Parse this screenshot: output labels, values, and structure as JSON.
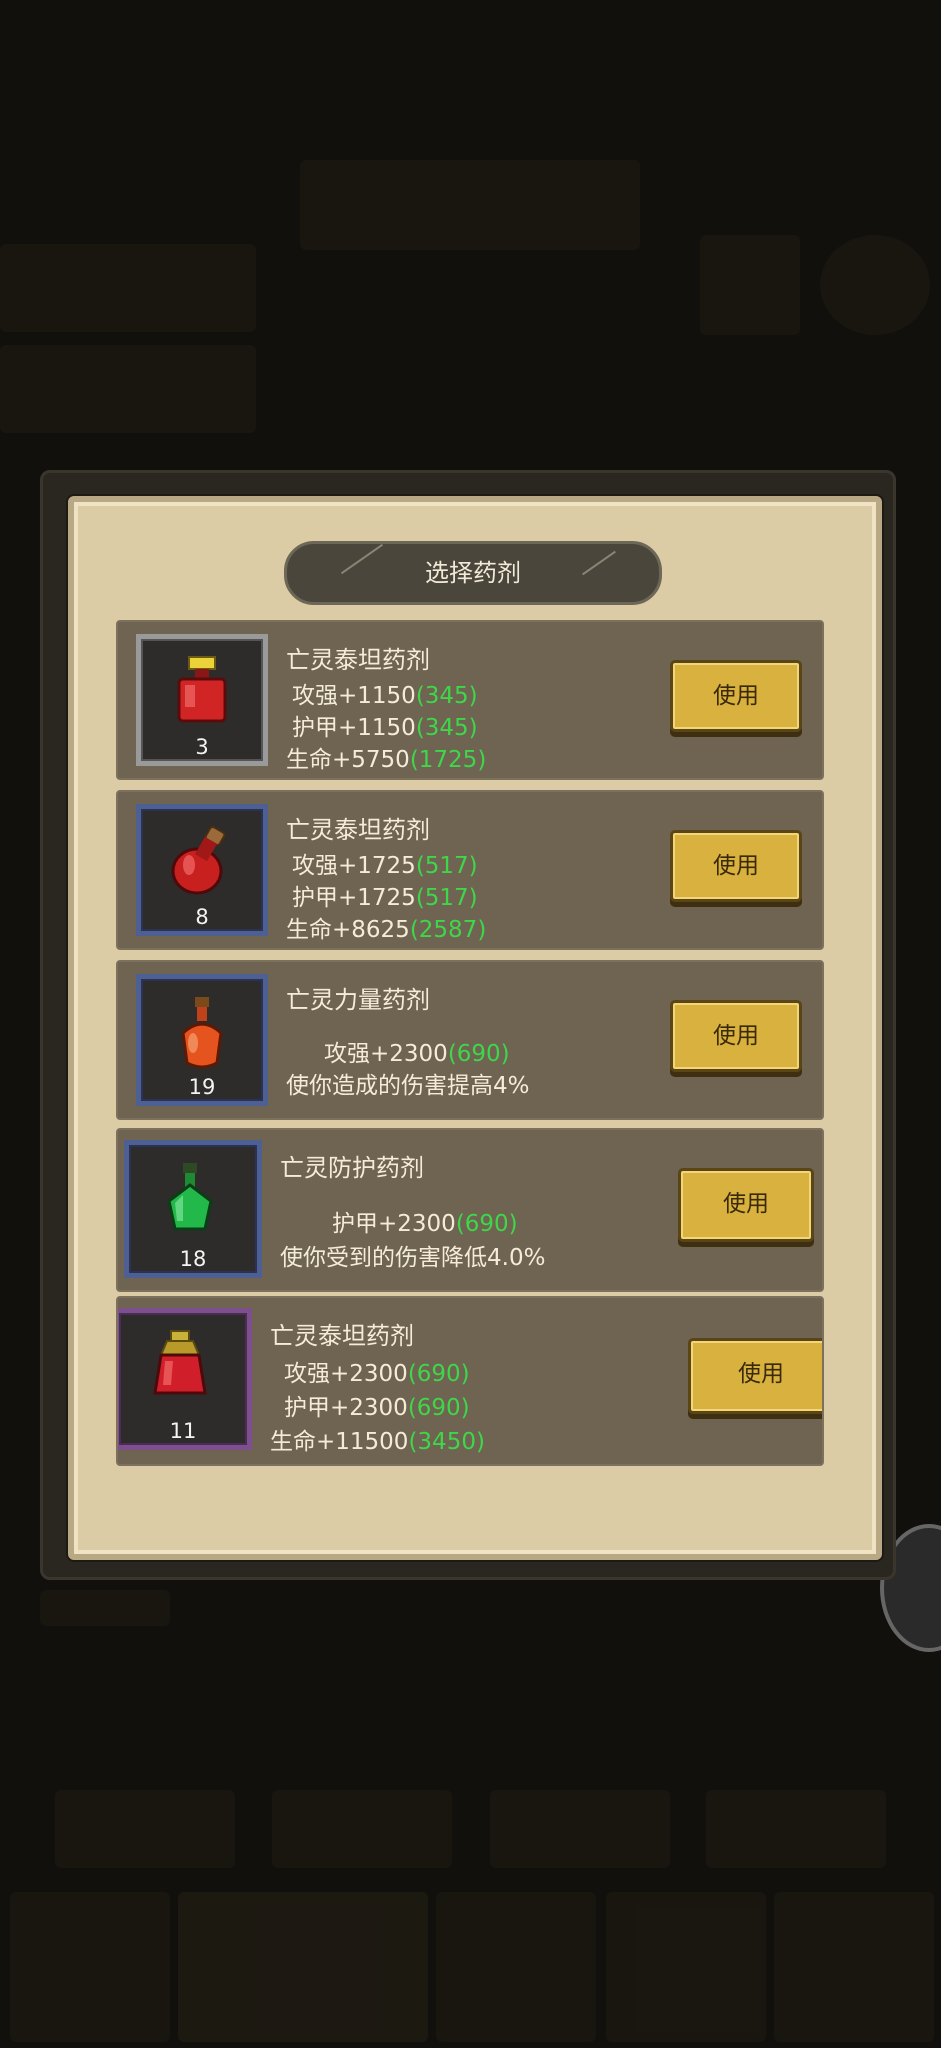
{
  "dialog": {
    "title": "选择药剂",
    "use_label": "使用"
  },
  "potions": [
    {
      "name": "亡灵泰坦药剂",
      "count": "3",
      "frame": "grey",
      "icon": "red-square-potion-icon",
      "stats": [
        {
          "label": "攻强+1150",
          "bonus": "(345)"
        },
        {
          "label": "护甲+1150",
          "bonus": "(345)"
        },
        {
          "label": "生命+5750",
          "bonus": "(1725)"
        }
      ]
    },
    {
      "name": "亡灵泰坦药剂",
      "count": "8",
      "frame": "blue",
      "icon": "red-flask-potion-icon",
      "stats": [
        {
          "label": "攻强+1725",
          "bonus": "(517)"
        },
        {
          "label": "护甲+1725",
          "bonus": "(517)"
        },
        {
          "label": "生命+8625",
          "bonus": "(2587)"
        }
      ]
    },
    {
      "name": "亡灵力量药剂",
      "count": "19",
      "frame": "blue",
      "icon": "orange-potion-icon",
      "stats": [
        {
          "label": "攻强+2300",
          "bonus": "(690)"
        },
        {
          "label": "使你造成的伤害提高4%",
          "bonus": ""
        }
      ]
    },
    {
      "name": "亡灵防护药剂",
      "count": "18",
      "frame": "blue",
      "icon": "green-potion-icon",
      "stats": [
        {
          "label": "护甲+2300",
          "bonus": "(690)"
        },
        {
          "label": "使你受到的伤害降低4.0%",
          "bonus": ""
        }
      ]
    },
    {
      "name": "亡灵泰坦药剂",
      "count": "11",
      "frame": "purple",
      "icon": "red-gold-potion-icon",
      "stats": [
        {
          "label": "攻强+2300",
          "bonus": "(690)"
        },
        {
          "label": "护甲+2300",
          "bonus": "(690)"
        },
        {
          "label": "生命+11500",
          "bonus": "(3450)"
        }
      ]
    }
  ],
  "colors": {
    "bonus": "#3fd64a",
    "button": "#d8b13f",
    "panel": "#dccca5"
  }
}
